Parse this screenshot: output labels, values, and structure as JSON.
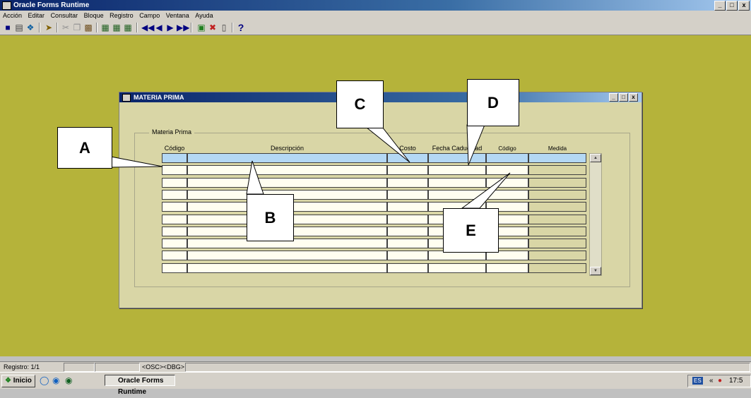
{
  "app": {
    "title": "Oracle Forms Runtime",
    "window_buttons": [
      "_",
      "□",
      "x"
    ]
  },
  "menu": [
    "Acción",
    "Editar",
    "Consultar",
    "Bloque",
    "Registro",
    "Campo",
    "Ventana",
    "Ayuda"
  ],
  "toolbar": {
    "help_label": "?"
  },
  "form": {
    "title": "MATERIA PRIMA",
    "window_buttons": [
      "_",
      "□",
      "x"
    ],
    "frame_label": "Materia Prima",
    "columns": [
      "Código",
      "Descripción",
      "Costo",
      "Fecha Caducidad",
      "Código",
      "Medida"
    ],
    "row_count": 10
  },
  "callouts": {
    "a": "A",
    "b": "B",
    "c": "C",
    "d": "D",
    "e": "E"
  },
  "status": {
    "record": "Registro: 1/1",
    "osc": "<OSC>",
    "dbg": "<DBG>"
  },
  "taskbar": {
    "start": "Inicio",
    "task": "Oracle Forms Runtime",
    "lang": "ES",
    "clock": "17:5"
  },
  "colors": {
    "workspace": "#b5b33a",
    "form_bg": "#d9d6a6",
    "selected_row": "#b4d8f4",
    "titlebar": "#0a246a"
  }
}
